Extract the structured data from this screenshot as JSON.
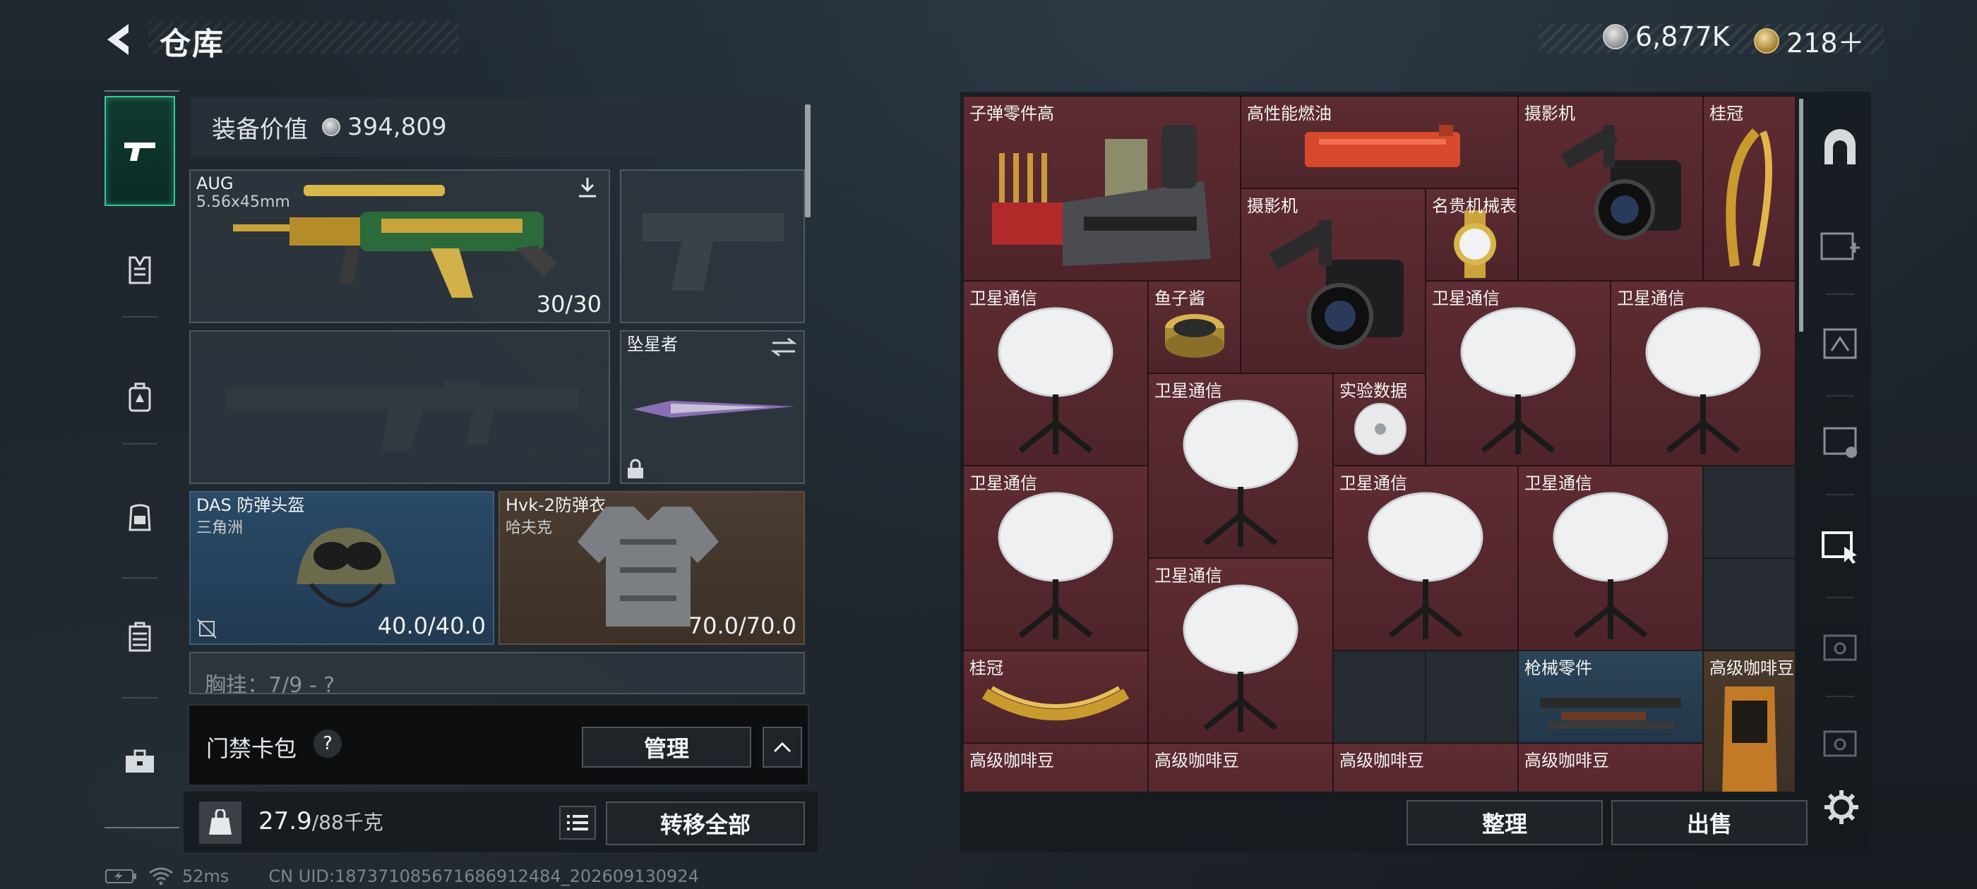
{
  "header": {
    "title": "仓库",
    "currency_silver": "6,877K",
    "currency_gold": "218＋"
  },
  "left_nav": {
    "items": [
      "pistol-icon",
      "armor-vest-icon",
      "backpack-icon",
      "rig-icon",
      "case-icon",
      "toolbox-icon"
    ]
  },
  "equipment": {
    "value_label": "装备价值",
    "value": "394,809",
    "primary": {
      "name": "AUG",
      "caliber": "5.56x45mm",
      "ammo": "30/30"
    },
    "melee": {
      "name": "坠星者"
    },
    "helmet": {
      "name": "DAS 防弹头盔",
      "sub": "三角洲",
      "durability": "40.0/40.0"
    },
    "armor": {
      "name": "Hvk-2防弹衣",
      "sub": "哈夫克",
      "durability": "70.0/70.0"
    },
    "chest_rig_partial": "胸挂：7/9 - ?"
  },
  "gatecard": {
    "label": "门禁卡包",
    "help": "?",
    "manage_label": "管理"
  },
  "weight": {
    "current": "27.9",
    "capacity": "/88千克",
    "transfer_label": "转移全部"
  },
  "status": {
    "ping": "52ms",
    "uid": "CN UID:18737108567168691248​4_202609130924"
  },
  "stash_items": [
    {
      "name": "子弹零件高"
    },
    {
      "name": "高性能燃油"
    },
    {
      "name": "摄影机"
    },
    {
      "name": "桂冠"
    },
    {
      "name": "摄影机"
    },
    {
      "name": "名贵机械表"
    },
    {
      "name": "卫星通信"
    },
    {
      "name": "鱼子酱"
    },
    {
      "name": "卫星通信"
    },
    {
      "name": "卫星通信"
    },
    {
      "name": "卫星通信"
    },
    {
      "name": "实验数据"
    },
    {
      "name": "卫星通信"
    },
    {
      "name": "卫星通信"
    },
    {
      "name": "卫星通信"
    },
    {
      "name": "卫星通信"
    },
    {
      "name": "桂冠"
    },
    {
      "name": "枪械零件"
    },
    {
      "name": "高级咖啡豆"
    },
    {
      "name": "高级咖啡豆"
    },
    {
      "name": "高级咖啡豆"
    },
    {
      "name": "高级咖啡豆"
    },
    {
      "name": "高级咖啡豆"
    }
  ],
  "stash_actions": {
    "sort_label": "整理",
    "sell_label": "出售"
  },
  "colors": {
    "accent": "#35c793",
    "item_red": "#5a2a30",
    "item_blue": "#2c4558"
  }
}
